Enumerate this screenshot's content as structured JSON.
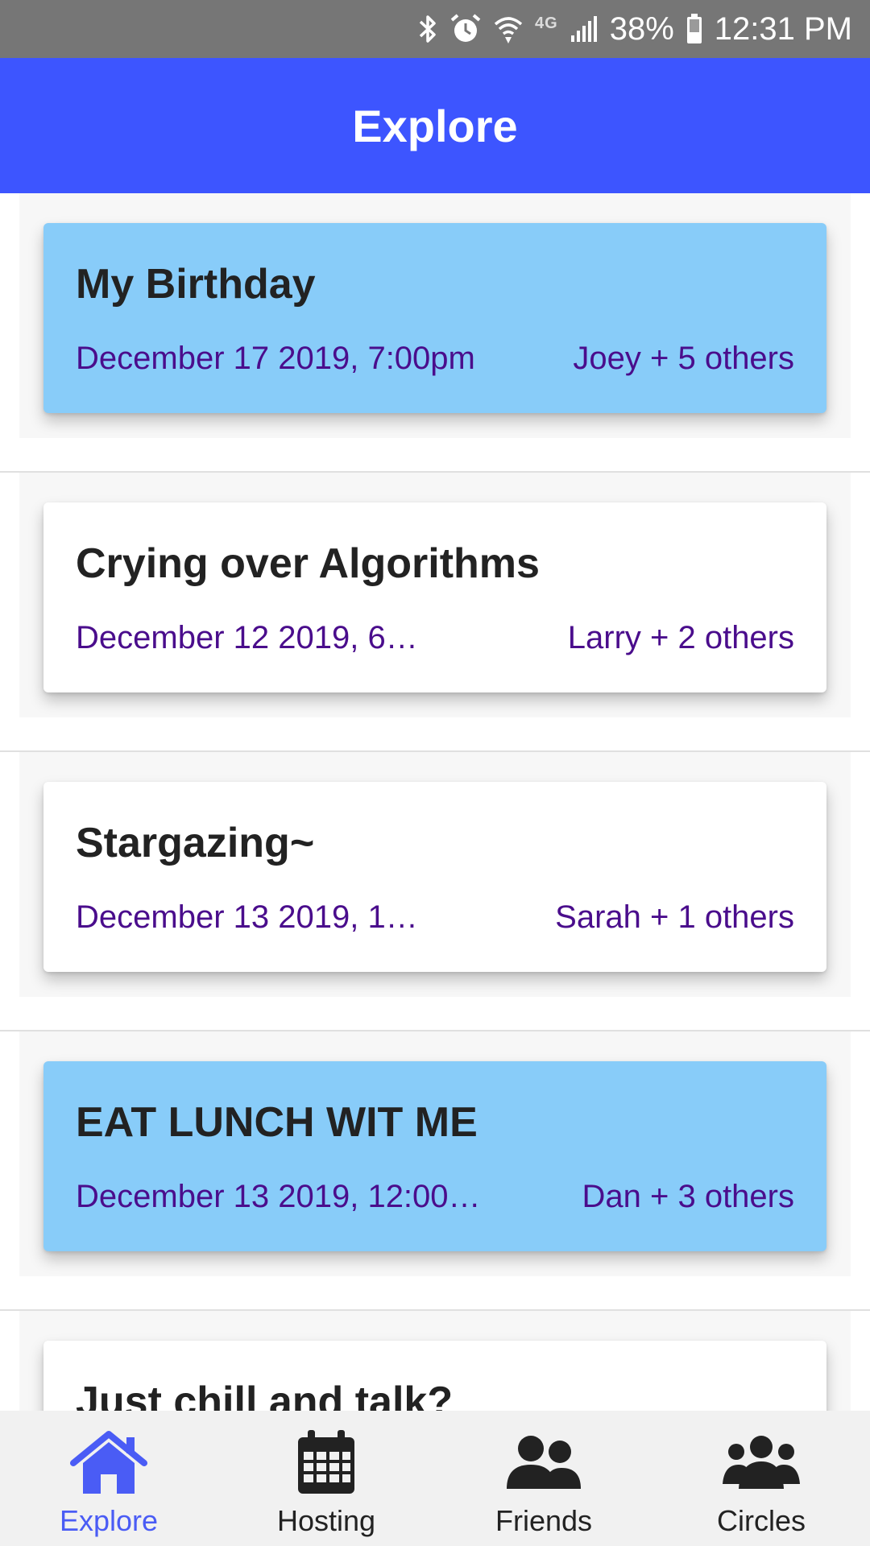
{
  "status_bar": {
    "network_label": "4G",
    "battery": "38%",
    "time": "12:31 PM",
    "icons": [
      "bluetooth-icon",
      "alarm-icon",
      "wifi-icon",
      "signal-icon",
      "battery-icon"
    ]
  },
  "app_bar": {
    "title": "Explore"
  },
  "colors": {
    "app_bar": "#3d55ff",
    "card_highlight": "#88ccf9",
    "meta_text": "#4a0d8c",
    "nav_active": "#4a5cf5"
  },
  "events": [
    {
      "title": "My Birthday",
      "date": "December 17 2019, 7:00pm",
      "people": "Joey + 5 others",
      "highlight": true
    },
    {
      "title": "Crying over Algorithms",
      "date": "December 12 2019, 6…",
      "people": "Larry + 2 others",
      "highlight": false
    },
    {
      "title": "Stargazing~",
      "date": "December 13 2019, 1…",
      "people": "Sarah + 1 others",
      "highlight": false
    },
    {
      "title": "EAT LUNCH WIT ME",
      "date": "December 13 2019, 12:00…",
      "people": "Dan + 3 others",
      "highlight": true
    },
    {
      "title": "Just chill and talk?",
      "date": "",
      "people": "",
      "highlight": false
    }
  ],
  "bottom_nav": {
    "items": [
      {
        "label": "Explore",
        "icon": "home-icon",
        "active": true
      },
      {
        "label": "Hosting",
        "icon": "calendar-icon",
        "active": false
      },
      {
        "label": "Friends",
        "icon": "friends-icon",
        "active": false
      },
      {
        "label": "Circles",
        "icon": "circles-icon",
        "active": false
      }
    ]
  }
}
